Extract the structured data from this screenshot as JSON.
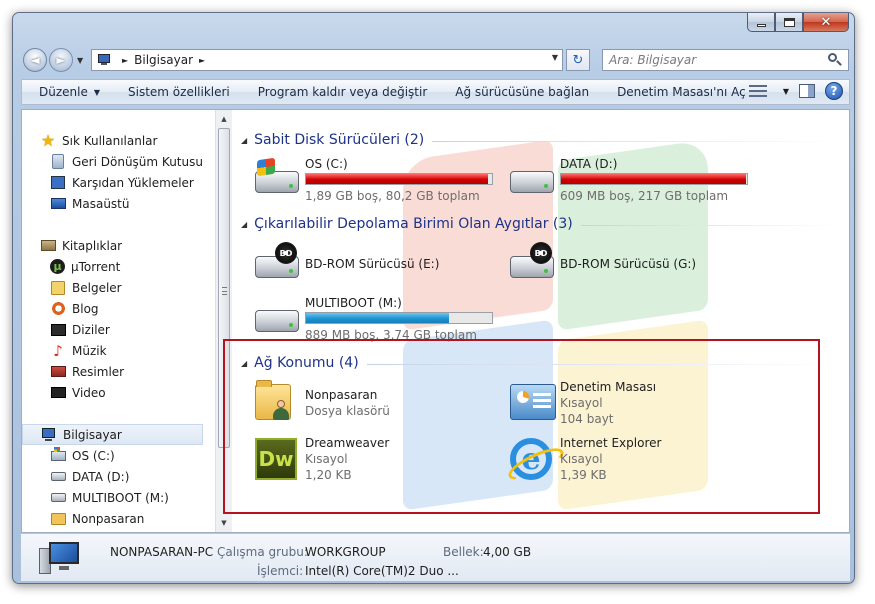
{
  "window": {
    "minimize_label": "",
    "maximize_label": "",
    "close_label": "✕"
  },
  "navigation": {
    "back_glyph": "◄",
    "forward_glyph": "►",
    "breadcrumb": [
      "Bilgisayar"
    ],
    "search_placeholder": "Ara: Bilgisayar",
    "refresh_glyph": "↻"
  },
  "toolbar": {
    "items": [
      "Düzenle",
      "Sistem özellikleri",
      "Program kaldır veya değiştir",
      "Ağ sürücüsüne bağlan",
      "Denetim Masası'nı Aç"
    ],
    "help_label": "?"
  },
  "sidebar": {
    "favorites": {
      "title": "Sık Kullanılanlar",
      "items": [
        "Geri Dönüşüm Kutusu",
        "Karşıdan Yüklemeler",
        "Masaüstü"
      ]
    },
    "libraries": {
      "title": "Kitaplıklar",
      "items": [
        "µTorrent",
        "Belgeler",
        "Blog",
        "Diziler",
        "Müzik",
        "Resimler",
        "Video"
      ]
    },
    "computer": {
      "title": "Bilgisayar",
      "items": [
        "OS (C:)",
        "DATA (D:)",
        "MULTIBOOT (M:)",
        "Nonpasaran"
      ]
    }
  },
  "content": {
    "groups": {
      "hard_disks": {
        "title": "Sabit Disk Sürücüleri (2)",
        "items": [
          {
            "name": "OS (C:)",
            "info": "1,89 GB boş, 80,2 GB toplam",
            "used_fraction": 0.976,
            "bar_color": "#d00000"
          },
          {
            "name": "DATA (D:)",
            "info": "609 MB boş, 217 GB toplam",
            "used_fraction": 0.997,
            "bar_color": "#d00000"
          }
        ]
      },
      "removable": {
        "title": "Çıkarılabilir Depolama Birimi Olan Aygıtlar (3)",
        "items": [
          {
            "name": "BD-ROM Sürücüsü (E:)",
            "badge": "BD"
          },
          {
            "name": "BD-ROM Sürücüsü (G:)",
            "badge": "BD"
          },
          {
            "name": "MULTIBOOT (M:)",
            "info": "889 MB boş, 3,74 GB toplam",
            "used_fraction": 0.768,
            "bar_color": "#1e94d2"
          }
        ]
      },
      "network": {
        "title": "Ağ Konumu (4)",
        "items": [
          {
            "name": "Nonpasaran",
            "type": "Dosya klasörü",
            "size": ""
          },
          {
            "name": "Denetim Masası",
            "type": "Kısayol",
            "size": "104 bayt"
          },
          {
            "name": "Dreamweaver",
            "type": "Kısayol",
            "size": "1,20 KB",
            "icon_text": "Dw"
          },
          {
            "name": "Internet Explorer",
            "type": "Kısayol",
            "size": "1,39 KB",
            "icon_text": "e"
          }
        ]
      }
    }
  },
  "details": {
    "computer_name": "NONPASARAN-PC",
    "workgroup_label": "Çalışma grubu:",
    "workgroup_value": "WORKGROUP",
    "memory_label": "Bellek:",
    "memory_value": "4,00 GB",
    "processor_label": "İşlemci:",
    "processor_value": "Intel(R) Core(TM)2 Duo ..."
  },
  "colors": {
    "accent_title": "#1e3287",
    "highlight_border": "#b3121e",
    "drive_full": "#d00000",
    "drive_ok": "#1e94d2"
  }
}
